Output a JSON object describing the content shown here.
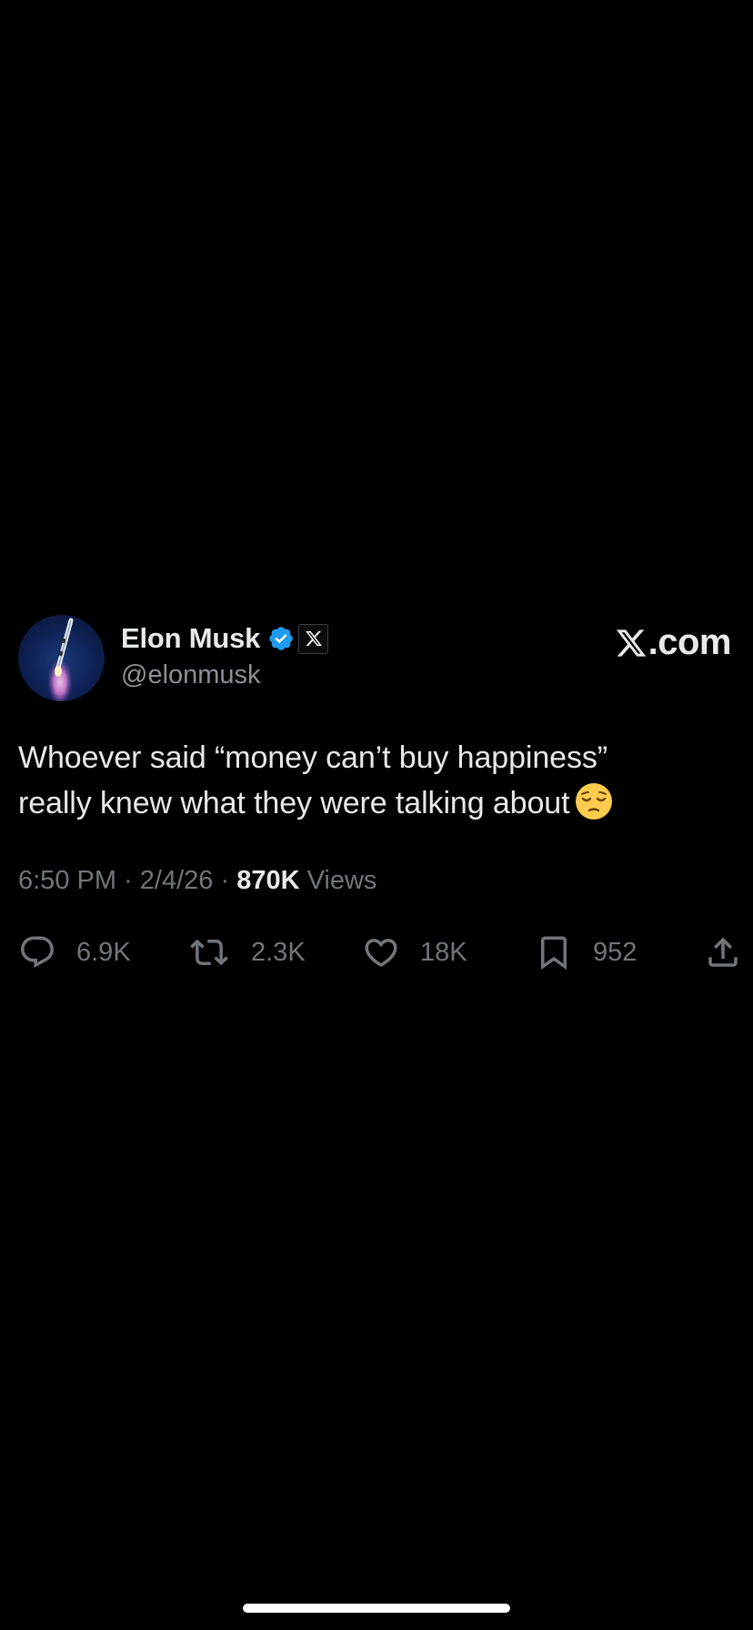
{
  "tweet": {
    "author": {
      "display_name": "Elon Musk",
      "handle": "@elonmusk",
      "verified": true,
      "affiliation_badge": "x-logo-icon"
    },
    "brand": {
      "suffix": ".com"
    },
    "text_line1": "Whoever said “money can’t buy happiness”",
    "text_line2": "really knew what they were talking about",
    "emoji": "pensive-face",
    "meta": {
      "time": "6:50 PM",
      "sep1": " · ",
      "date": "2/4/26",
      "sep2": " · ",
      "views_count": "870K",
      "views_label": " Views"
    },
    "actions": {
      "replies": "6.9K",
      "reposts": "2.3K",
      "likes": "18K",
      "bookmarks": "952"
    }
  },
  "colors": {
    "background": "#000000",
    "text_primary": "#e7e9ea",
    "text_secondary": "#71767b",
    "verified_blue": "#1d9bf0"
  }
}
